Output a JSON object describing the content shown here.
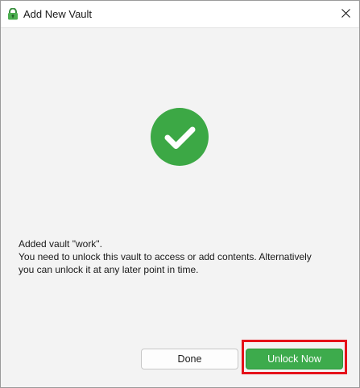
{
  "window": {
    "title": "Add New Vault",
    "app_icon": "cryptomator-lock-icon",
    "close_icon": "close-icon"
  },
  "content": {
    "status_icon": "checkmark-circle-icon",
    "status_color": "#3ca845",
    "message_lines": [
      "Added vault \"work\".",
      "You need to unlock this vault to access or add contents. Alternatively",
      "you can unlock it at any later point in time."
    ]
  },
  "buttons": {
    "done_label": "Done",
    "unlock_label": "Unlock Now",
    "unlock_color": "#3dab4c",
    "highlight_color": "#e5121a"
  }
}
